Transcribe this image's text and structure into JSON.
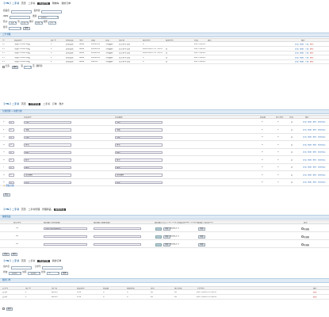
{
  "s1": {
    "brand": "【 TN 】二手书",
    "tabs": [
      {
        "label": "首页"
      },
      {
        "label": "二手书"
      },
      {
        "label": "商品管理",
        "active": true
      },
      {
        "label": "购物车"
      },
      {
        "label": "我的订单"
      }
    ],
    "filters": {
      "name_label": "商品名:",
      "seller_label": "发布者:",
      "isbn_label": "ISBN:",
      "category_label": "类别:",
      "category_value": "--请选择--",
      "price_label": "售价:",
      "price_min": "全部",
      "price_mid": "到",
      "price_max": "全部",
      "order_label": "排序:",
      "order_value": "价格",
      "by_label": "按照",
      "by_value": "升序"
    },
    "search_btn": "搜索",
    "section_title": "二手书籍",
    "headers": [
      "ID",
      "商品名称",
      "商户ID",
      "价格分类",
      "单价",
      "总量",
      "分类",
      "所在地",
      "发布时间",
      "更新时间",
      "状态",
      "备注",
      "操作"
    ],
    "rows": [
      [
        "17",
        "苹果X 256G 95成",
        "1",
        "实物交易",
        "6666",
        "20000.00",
        "手机数码",
        "北京市丰台区",
        "0",
        "",
        "2017-09-14",
        "",
        ""
      ],
      [
        "17",
        "苹果X 256G 95成",
        "1",
        "实物交易",
        "6666",
        "20000.00",
        "手机数码",
        "北京市丰台区",
        "2020-09-07 07:54:23",
        "无",
        "2017-09-14",
        ""
      ],
      [
        "17",
        "苹果X 256G 95成",
        "1",
        "实物交易",
        "6666",
        "20000.00",
        "手机数码",
        "北京市丰台区",
        "2020-09-07 07:54:23",
        "无",
        "2017-09-14",
        ""
      ],
      [
        "17",
        "苹果X 256G 95成",
        "1",
        "实物交易",
        "6666",
        "20000.00",
        "手机数码",
        "北京市丰台区",
        "0",
        "无",
        "2017-09-14",
        ""
      ],
      [
        "17",
        "苹果X 256G 95成",
        "1",
        "实物交易",
        "6666",
        "999.00",
        "手机数码",
        "北京市丰台区",
        "0",
        "无",
        "2017-09-14",
        ""
      ]
    ],
    "actions": [
      "查看",
      "编辑",
      "下架",
      "删除"
    ],
    "footer": {
      "select_all": "全选",
      "page_label": "第",
      "page_value": "1",
      "unit": "页",
      "jump": "跳转到"
    }
  },
  "s2": {
    "brand": "【 TN 】二手书",
    "tabs": [
      {
        "label": "首页"
      },
      {
        "label": "分类管理",
        "active": true
      },
      {
        "label": "二手书"
      },
      {
        "label": "订单"
      },
      {
        "label": "账户"
      }
    ],
    "section_title": "分类管理 > 新增分类",
    "headers": [
      "",
      "分类名称",
      "分类描述",
      "商品数",
      "显示排序",
      "状态",
      "操作"
    ],
    "rows": [
      {
        "id": "1",
        "name": "手机",
        "desc": "手机",
        "count": "6",
        "order": "0",
        "state": "是"
      },
      {
        "id": "2",
        "name": "电脑",
        "desc": "电脑",
        "count": "6",
        "order": "0",
        "state": "是"
      },
      {
        "id": "3",
        "name": "平板",
        "desc": "平板",
        "count": "6",
        "order": "0",
        "state": "是"
      },
      {
        "id": "4",
        "name": "家电",
        "desc": "家电",
        "count": "6",
        "order": "0",
        "state": "是"
      },
      {
        "id": "5",
        "name": "相机",
        "desc": "相机",
        "count": "6",
        "order": "0",
        "state": "是"
      },
      {
        "id": "6",
        "name": "图书",
        "desc": "图书",
        "count": "6",
        "order": "0",
        "state": "是"
      },
      {
        "id": "7",
        "name": "服装",
        "desc": "服装",
        "count": "6",
        "order": "0",
        "state": "是"
      },
      {
        "id": "8",
        "name": "运动器材",
        "desc": "运动器材",
        "count": "6",
        "order": "0",
        "state": "是"
      },
      {
        "id": "9",
        "name": "其他",
        "desc": "其他",
        "count": "6",
        "order": "0",
        "state": "是"
      }
    ],
    "actions": [
      "查看",
      "编辑",
      "删除",
      "管理商品"
    ],
    "add_link": "添加分类",
    "submit": "提交"
  },
  "s3": {
    "brand": "【 TN 】二手书",
    "tabs": [
      {
        "label": "首页"
      },
      {
        "label": "二手书管理"
      },
      {
        "label": "管理商品"
      },
      {
        "label": "编辑商品",
        "active": true
      }
    ],
    "section_title": "编辑商品",
    "headers": [
      "显示序号",
      "配置图片名称(选填)",
      "配置图片链接(选填)",
      "配置图片(尺寸:750*375(手机版)或1920*375(PC版)图片不超过1M)",
      "类型"
    ],
    "rows": [
      {
        "id": "01",
        "name": "苹果手机256G成色",
        "link": "",
        "btn": "浏览",
        "file": "未选择文件",
        "radio": "轮播图"
      },
      {
        "id": "02",
        "name": "",
        "link": "",
        "btn": "浏览",
        "file": "未选择文件",
        "radio": "轮播图"
      },
      {
        "id": "03",
        "name": "",
        "link": "",
        "btn": "浏览",
        "file": "未选择文件",
        "radio": "轮播图"
      }
    ],
    "footer_btn": "添加",
    "submit": "保存"
  },
  "s4": {
    "brand": "【 TN 】二手书",
    "tabs": [
      {
        "label": "首页"
      },
      {
        "label": "二手书"
      },
      {
        "label": "商品管理",
        "active": true
      },
      {
        "label": "我的订单"
      }
    ],
    "filters": {
      "user_label": "用户名:",
      "order_label": "订单号:",
      "state_label": "状态:",
      "state_value": "--请选择--",
      "time_label": "时间:",
      "time_value": "--请选择--",
      "sort_label": "排序:",
      "sort_value": "ID"
    },
    "search_btn": "搜索",
    "section_title": "我的订单",
    "headers": [
      "订单号",
      "用户ID",
      "用户名",
      "商品名称",
      "商品数",
      "邮费价格",
      "总价",
      "支付状态",
      "下单时间",
      "操作"
    ],
    "rows": [
      [
        "订单1",
        "1",
        "admin",
        "1.00",
        "0",
        "0",
        "¥0",
        "¥0",
        "2017-09-12 13:19:27",
        "删除"
      ],
      [
        "订单2",
        "1",
        "admin",
        "1.00",
        "0",
        "0",
        "¥0",
        "¥0",
        "2017-09-12 13:19:28",
        "删除"
      ]
    ]
  }
}
